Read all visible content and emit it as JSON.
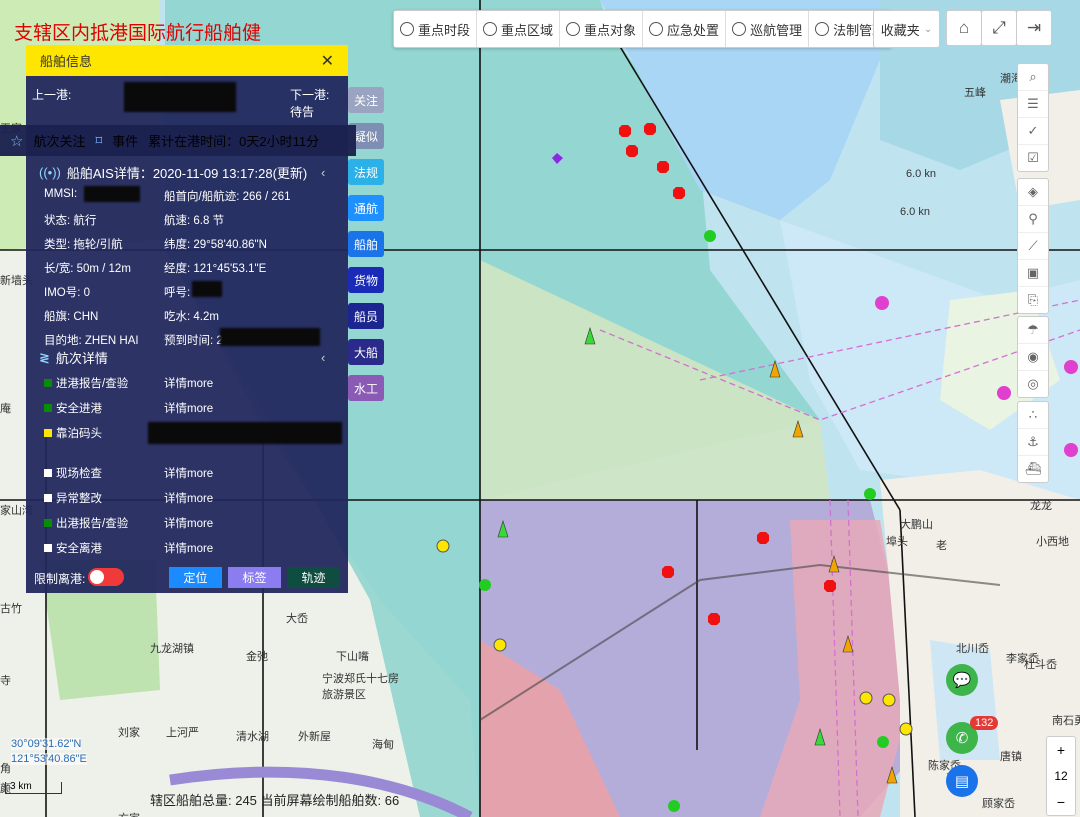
{
  "title": "支辖区内抵港国际航行船舶健",
  "toolbar": {
    "items": [
      {
        "label": "重点时段",
        "icon": "clock-icon"
      },
      {
        "label": "重点区域",
        "icon": "location-icon"
      },
      {
        "label": "重点对象",
        "icon": "target-icon"
      },
      {
        "label": "应急处置",
        "icon": "alarm-icon"
      },
      {
        "label": "巡航管理",
        "icon": "document-icon"
      },
      {
        "label": "法制管理",
        "icon": "truck-icon"
      }
    ],
    "favorites": "收藏夹"
  },
  "panel": {
    "title": "船舶信息",
    "prev_port_label": "上一港:",
    "next_port_label": "下一港:",
    "next_port_value": "待告",
    "attention": "航次关注",
    "event": "事件",
    "stay_time": "累计在港时间：0天2小时11分",
    "ais_title": "船舶AIS详情：2020-11-09 13:17:28(更新)",
    "ais": {
      "mmsi": "MMSI:",
      "heading": "船首向/船航迹: 266 / 261",
      "status": "状态: 航行",
      "speed": "航速: 6.8 节",
      "type": "类型: 拖轮/引航",
      "lat": "纬度: 29°58'40.86\"N",
      "size": "长/宽: 50m / 12m",
      "lon": "经度: 121°45'53.1\"E",
      "imo": "IMO号: 0",
      "callsign": "呼号:",
      "flag": "船旗: CHN",
      "draft": "吃水: 4.2m",
      "dest": "目的地: ZHEN HAI",
      "eta": "预到时间: 20"
    },
    "voyage_title": "航次详情",
    "voyage_items": [
      {
        "label": "进港报告/查验",
        "color": "#0a8a0a",
        "more": "详情more"
      },
      {
        "label": "安全进港",
        "color": "#0a8a0a",
        "more": "详情more"
      },
      {
        "label": "靠泊码头",
        "color": "#ffe600",
        "more": ""
      },
      {
        "label": "现场检查",
        "color": "#ffffff",
        "more": "详情more"
      },
      {
        "label": "异常整改",
        "color": "#ffffff",
        "more": "详情more"
      },
      {
        "label": "出港报告/查验",
        "color": "#0a8a0a",
        "more": "详情more"
      },
      {
        "label": "安全离港",
        "color": "#ffffff",
        "more": "详情more"
      }
    ],
    "restrict_label": "限制离港:",
    "btn_locate": "定位",
    "btn_tag": "标签",
    "btn_track": "轨迹"
  },
  "side_tags": [
    {
      "label": "关注",
      "color": "#9aa3c0"
    },
    {
      "label": "疑似",
      "color": "#7e8fb3"
    },
    {
      "label": "法规",
      "color": "#2bb0e8"
    },
    {
      "label": "通航",
      "color": "#1e90ff"
    },
    {
      "label": "船舶",
      "color": "#1a73e8"
    },
    {
      "label": "货物",
      "color": "#1a2bb8"
    },
    {
      "label": "船员",
      "color": "#1c2590"
    },
    {
      "label": "大船",
      "color": "#2a2a8a"
    },
    {
      "label": "水工",
      "color": "#8a5ab5"
    }
  ],
  "coords": {
    "lat": "30°09'31.62\"N",
    "lon": "121°53'40.86\"E"
  },
  "scale": "3 km",
  "status_bar": "辖区船舶总量: 245    当前屏幕绘制船舶数: 66",
  "zoom": {
    "plus": "+",
    "level": "12",
    "minus": "−"
  },
  "badge": "132",
  "map_labels": [
    "宁波郑氏十七房旅游景区",
    "九龙湖镇",
    "下山嘴",
    "大岙",
    "金弛",
    "外新屋",
    "刘家",
    "上河严",
    "清水湖",
    "海甸",
    "大鹏山",
    "埠头",
    "老",
    "小西地",
    "龙龙",
    "北川岙",
    "李家岙",
    "杜斗岙",
    "南石勇",
    "唐镇",
    "陈家岙",
    "夏",
    "顾家岙",
    "新墙头",
    "家山湾",
    "古竹",
    "庵",
    "王家",
    "寺",
    "角",
    "颜",
    "方家",
    "五峰",
    "潮海",
    "6.0 kn",
    "6.0 kn"
  ]
}
